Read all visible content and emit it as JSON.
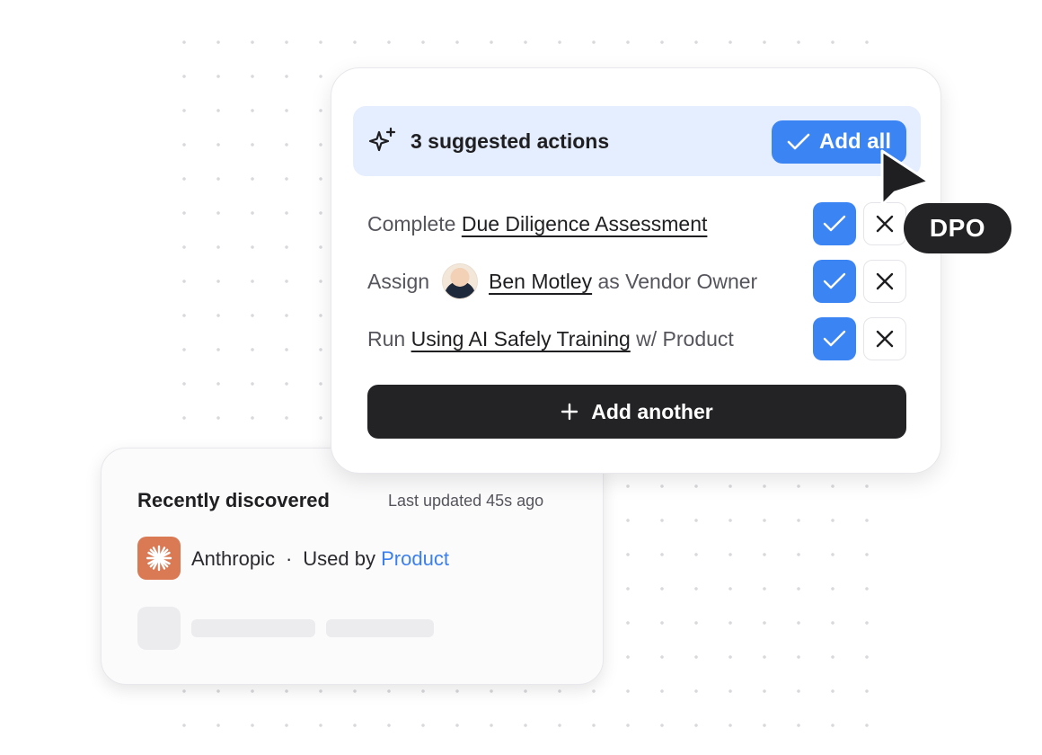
{
  "colors": {
    "accent": "#3b84f4",
    "header_bg": "#e5eeff",
    "dark": "#232326",
    "link": "#3b7ff0",
    "anthropic_logo": "#d97a55"
  },
  "suggestions": {
    "icon": "sparkle-icon",
    "title": "3 suggested actions",
    "add_all_label": "Add all",
    "actions": [
      {
        "prefix": "Complete",
        "link": "Due Diligence Assessment",
        "suffix": ""
      },
      {
        "prefix": "Assign",
        "link": "Ben Motley",
        "suffix": "as Vendor Owner",
        "avatar": "avatar-ben-motley"
      },
      {
        "prefix": "Run",
        "link": "Using AI Safely Training",
        "suffix": "w/ Product"
      }
    ],
    "add_another_label": "Add another"
  },
  "cursor_badge": "DPO",
  "recently_discovered": {
    "title": "Recently discovered",
    "updated": "Last updated 45s ago",
    "vendor": "Anthropic",
    "separator": "·",
    "used_by_label": "Used by",
    "used_by_link": "Product"
  }
}
